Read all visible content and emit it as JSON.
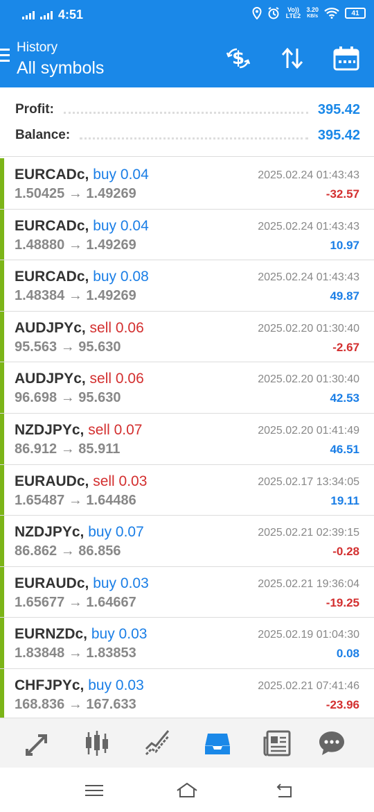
{
  "status_bar": {
    "time": "4:51",
    "network_label": "Vo)) LTE2",
    "speed_value": "3.20",
    "speed_unit": "KB/s",
    "battery": "41"
  },
  "header": {
    "title": "History",
    "subtitle": "All symbols"
  },
  "summary": {
    "profit_label": "Profit:",
    "profit_value": "395.42",
    "balance_label": "Balance:",
    "balance_value": "395.42"
  },
  "trades": [
    {
      "symbol": "EURCADc,",
      "side": "buy 0.04",
      "prices": "1.50425 → 1.49269",
      "time": "2025.02.24 01:43:43",
      "pl": "-32.57"
    },
    {
      "symbol": "EURCADc,",
      "side": "buy 0.04",
      "prices": "1.48880 → 1.49269",
      "time": "2025.02.24 01:43:43",
      "pl": "10.97"
    },
    {
      "symbol": "EURCADc,",
      "side": "buy 0.08",
      "prices": "1.48384 → 1.49269",
      "time": "2025.02.24 01:43:43",
      "pl": "49.87"
    },
    {
      "symbol": "AUDJPYc,",
      "side": "sell 0.06",
      "prices": "95.563 → 95.630",
      "time": "2025.02.20 01:30:40",
      "pl": "-2.67"
    },
    {
      "symbol": "AUDJPYc,",
      "side": "sell 0.06",
      "prices": "96.698 → 95.630",
      "time": "2025.02.20 01:30:40",
      "pl": "42.53"
    },
    {
      "symbol": "NZDJPYc,",
      "side": "sell 0.07",
      "prices": "86.912 → 85.911",
      "time": "2025.02.20 01:41:49",
      "pl": "46.51"
    },
    {
      "symbol": "EURAUDc,",
      "side": "sell 0.03",
      "prices": "1.65487 → 1.64486",
      "time": "2025.02.17 13:34:05",
      "pl": "19.11"
    },
    {
      "symbol": "NZDJPYc,",
      "side": "buy 0.07",
      "prices": "86.862 → 86.856",
      "time": "2025.02.21 02:39:15",
      "pl": "-0.28"
    },
    {
      "symbol": "EURAUDc,",
      "side": "buy 0.03",
      "prices": "1.65677 → 1.64667",
      "time": "2025.02.21 19:36:04",
      "pl": "-19.25"
    },
    {
      "symbol": "EURNZDc,",
      "side": "buy 0.03",
      "prices": "1.83848 → 1.83853",
      "time": "2025.02.19 01:04:30",
      "pl": "0.08"
    },
    {
      "symbol": "CHFJPYc,",
      "side": "buy 0.03",
      "prices": "168.836 → 167.633",
      "time": "2025.02.21 07:41:46",
      "pl": "-23.96"
    }
  ],
  "colors": {
    "brand": "#1a88e8",
    "buy": "#1a7ee6",
    "sell": "#d32f2f",
    "profit_bar": "#7cb518"
  },
  "icons": {
    "header_actions": [
      "dollar-swap-icon",
      "sort-icon",
      "calendar-icon"
    ],
    "bottom_nav": [
      "quotes-icon",
      "chart-icon",
      "trade-icon",
      "history-icon",
      "news-icon",
      "messages-icon"
    ]
  }
}
